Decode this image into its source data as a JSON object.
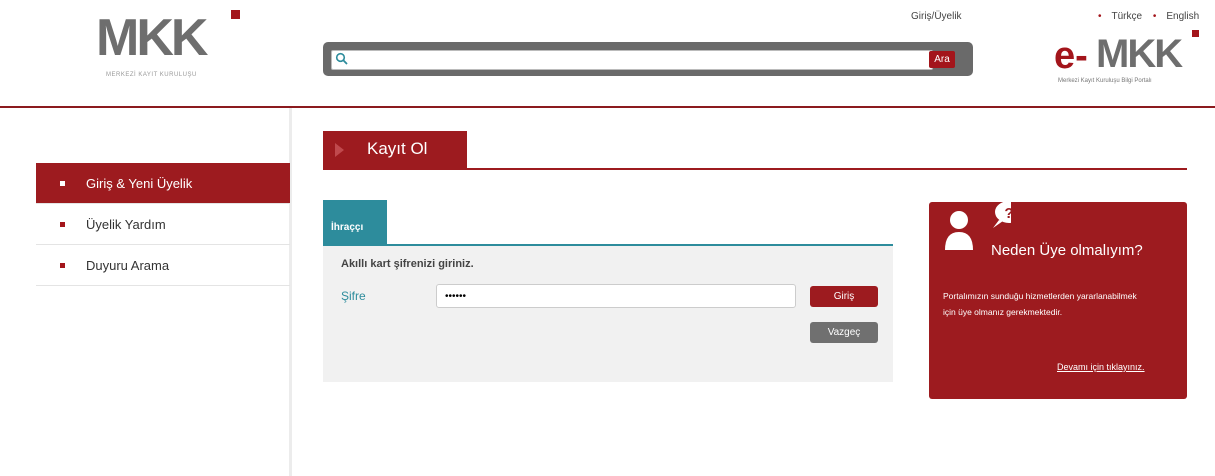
{
  "header": {
    "logo": {
      "text": "MKK",
      "subtitle": "MERKEZİ KAYIT KURULUŞU"
    },
    "search": {
      "placeholder": "",
      "button_label": "Ara"
    },
    "login_link": "Giriş/Üyelik",
    "languages": [
      "Türkçe",
      "English"
    ],
    "portal_logo": {
      "prefix": "e-",
      "text": "MKK",
      "subtitle": "Merkezi Kayıt Kuruluşu Bilgi Portalı"
    }
  },
  "sidebar": {
    "items": [
      {
        "label": "Giriş & Yeni Üyelik",
        "active": true
      },
      {
        "label": "Üyelik Yardım",
        "active": false
      },
      {
        "label": "Duyuru Arama",
        "active": false
      }
    ]
  },
  "page": {
    "title": "Kayıt Ol"
  },
  "login_panel": {
    "tab_label": "İhraççı",
    "instruction": "Akıllı kart şifrenizi giriniz.",
    "password_label": "Şifre",
    "password_value": "••••••",
    "login_button": "Giriş",
    "cancel_button": "Vazgeç"
  },
  "info_box": {
    "title": "Neden Üye olmalıyım?",
    "text": "Portalımızın sunduğu hizmetlerden yararlanabilmek için üye olmanız gerekmektedir.",
    "link": "Devamı için tıklayınız."
  },
  "colors": {
    "brand": "#9d1b1f",
    "teal": "#2d8c9c",
    "gray": "#6a6a6a"
  },
  "icons": [
    "search-icon",
    "person-question-icon"
  ]
}
